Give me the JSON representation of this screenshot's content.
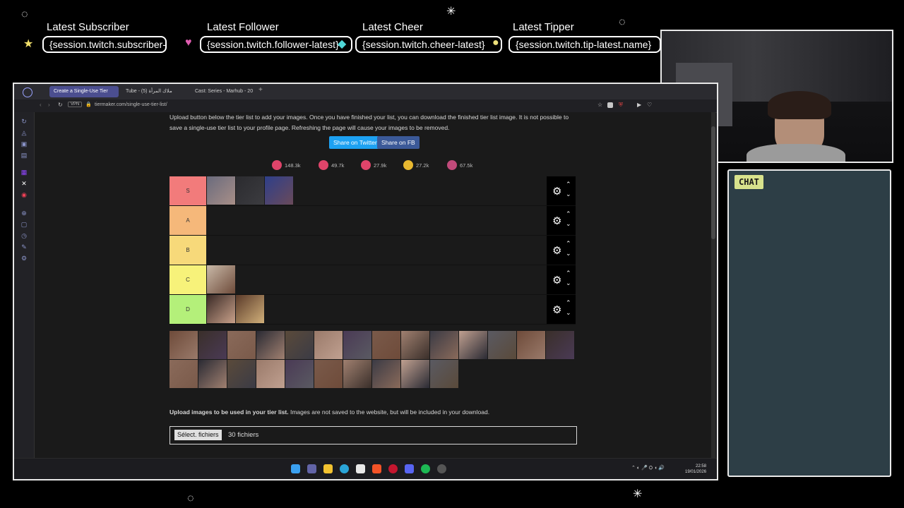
{
  "alerts": [
    {
      "label": "Latest Subscriber",
      "value": "{session.twitch.subscriber-latest}"
    },
    {
      "label": "Latest Follower",
      "value": "{session.twitch.follower-latest}"
    },
    {
      "label": "Latest Cheer",
      "value": "{session.twitch.cheer-latest}"
    },
    {
      "label": "Latest Tipper",
      "value": "{session.twitch.tip-latest.name}"
    }
  ],
  "chat": {
    "badge": "CHAT"
  },
  "browser": {
    "tabs": [
      {
        "label": "Create a Single-Use Tier",
        "active": true
      },
      {
        "label": "Tube - ملاك المرأة (5)",
        "active": false
      },
      {
        "label": "Cast: Series - Marhub - 20",
        "active": false
      }
    ],
    "url": "tiermaker.com/single-use-tier-list/",
    "vpn": "VPN"
  },
  "page": {
    "intro_text": "Upload button below the tier list to add your images. Once you have finished your list, you can download the finished tier list image. It is not possible to save a single-use tier list to your profile page. Refreshing the page will cause your images to be removed.",
    "share_twitter": "Share on Twitter",
    "share_fb": "Share on FB",
    "reactions": [
      {
        "icon": "laugh-emoji-icon",
        "count": "148.3k",
        "color": "#e0446a"
      },
      {
        "icon": "angry-emoji-icon",
        "count": "49.7k",
        "color": "#e0446a"
      },
      {
        "icon": "grin-emoji-icon",
        "count": "27.9k",
        "color": "#e0446a"
      },
      {
        "icon": "hands-emoji-icon",
        "count": "27.2k",
        "color": "#e8b830"
      },
      {
        "icon": "poop-emoji-icon",
        "count": "67.5k",
        "color": "#c04a7a"
      }
    ],
    "tiers": [
      {
        "label": "S",
        "color": "#f27b7b"
      },
      {
        "label": "A",
        "color": "#f5b87a"
      },
      {
        "label": "B",
        "color": "#f7d97a"
      },
      {
        "label": "C",
        "color": "#f7f27a"
      },
      {
        "label": "D",
        "color": "#b4f07a"
      }
    ],
    "upload_bold": "Upload images to be used in your tier list.",
    "upload_rest": " Images are not saved to the website, but will be included in your download.",
    "file_button": "Sélect. fichiers",
    "file_count": "30 fichiers"
  },
  "taskbar": {
    "time": "22:58",
    "date": "19/01/2026"
  }
}
